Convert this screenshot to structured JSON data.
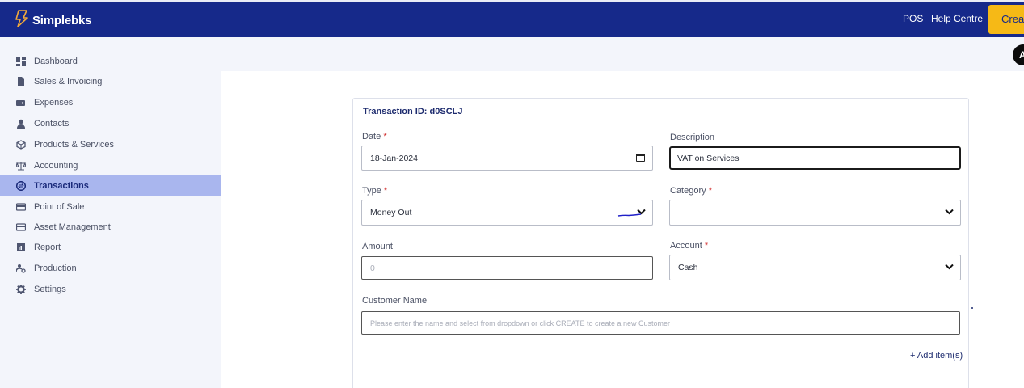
{
  "app": {
    "brand": "Simplebks",
    "nav_pos": "POS",
    "nav_help": "Help Centre",
    "create_label": "Creat",
    "avatar_initial": "A",
    "colors": {
      "topbar": "#16298a",
      "accent": "#f6b916",
      "active_nav": "#a9b6ee"
    }
  },
  "sidebar": {
    "items": [
      {
        "label": "Dashboard",
        "icon": "dashboard-icon"
      },
      {
        "label": "Sales & Invoicing",
        "icon": "file-icon"
      },
      {
        "label": "Expenses",
        "icon": "wallet-icon"
      },
      {
        "label": "Contacts",
        "icon": "user-icon"
      },
      {
        "label": "Products & Services",
        "icon": "box-icon"
      },
      {
        "label": "Accounting",
        "icon": "scale-icon"
      },
      {
        "label": "Transactions",
        "icon": "exchange-icon",
        "active": true
      },
      {
        "label": "Point of Sale",
        "icon": "card-icon"
      },
      {
        "label": "Asset Management",
        "icon": "card-icon"
      },
      {
        "label": "Report",
        "icon": "report-icon"
      },
      {
        "label": "Production",
        "icon": "production-icon"
      },
      {
        "label": "Settings",
        "icon": "gear-icon"
      }
    ]
  },
  "form": {
    "header": "Transaction ID: d0SCLJ",
    "date_label": "Date",
    "date_value": "18-Jan-2024",
    "description_label": "Description",
    "description_value": "VAT on Services",
    "type_label": "Type",
    "type_value": "Money Out",
    "category_label": "Category",
    "category_value": "",
    "amount_label": "Amount",
    "amount_placeholder": "0",
    "account_label": "Account",
    "account_value": "Cash",
    "customer_label": "Customer Name",
    "customer_placeholder": "Please enter the name and select from dropdown or click CREATE to create a new Customer",
    "required_marker": "*",
    "add_item_label": "+ Add item(s)"
  }
}
